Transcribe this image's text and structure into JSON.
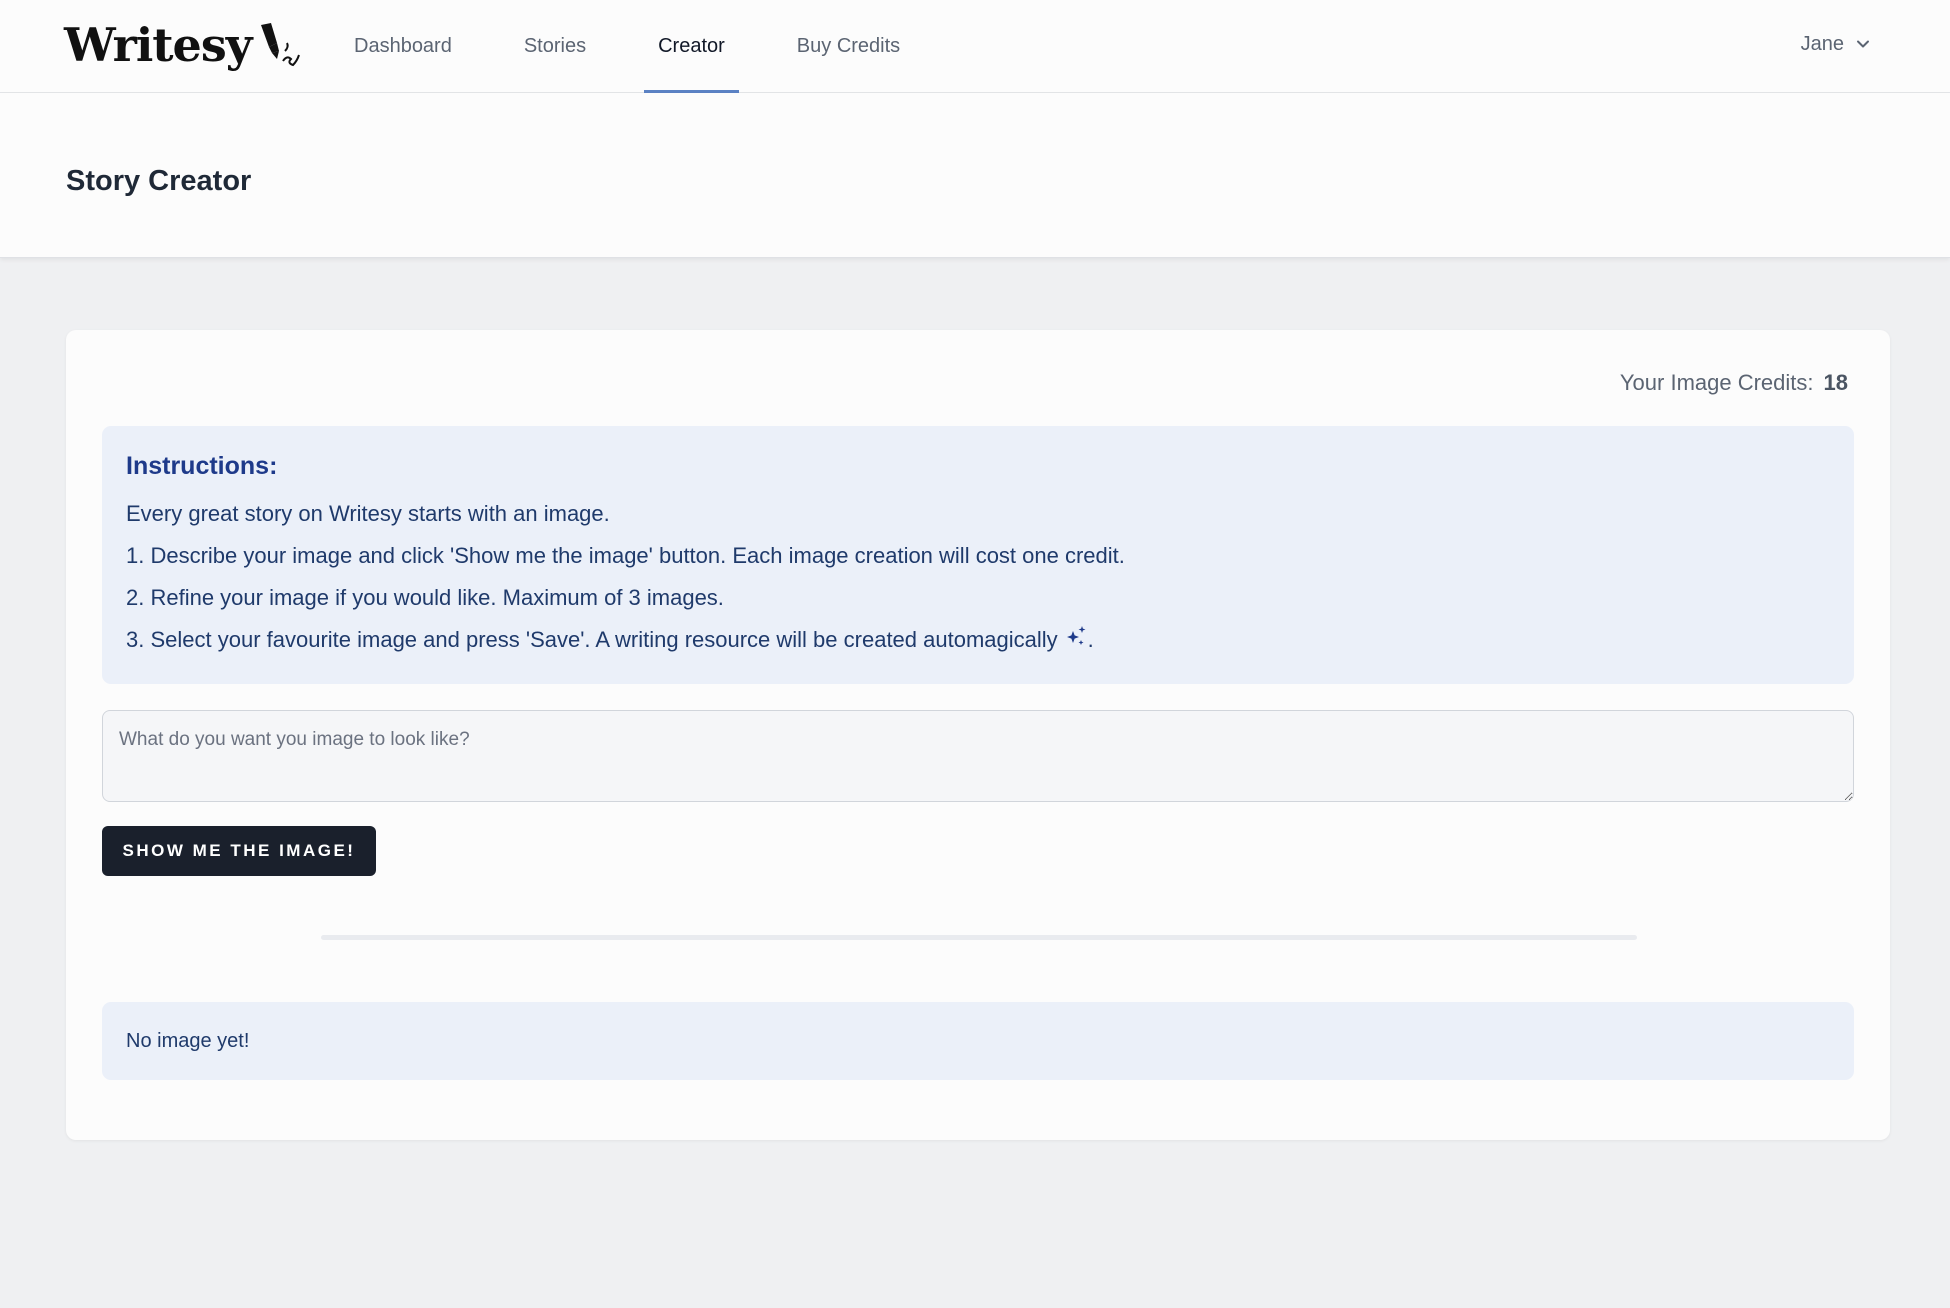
{
  "brand": {
    "name": "Writesy"
  },
  "nav": {
    "links": [
      {
        "label": "Dashboard",
        "active": false
      },
      {
        "label": "Stories",
        "active": false
      },
      {
        "label": "Creator",
        "active": true
      },
      {
        "label": "Buy Credits",
        "active": false
      }
    ],
    "user": "Jane"
  },
  "header": {
    "title": "Story Creator"
  },
  "card": {
    "credits_label": "Your Image Credits:",
    "credits_count": "18",
    "instructions": {
      "title": "Instructions:",
      "intro": "Every great story on Writesy starts with an image.",
      "step1": "1. Describe your image and click 'Show me the image' button. Each image creation will cost one credit.",
      "step2": "2. Refine your image if you would like. Maximum of 3 images.",
      "step3": "3. Select your favourite image and press 'Save'. A writing resource will be created automagically",
      "step3_end": "."
    },
    "prompt": {
      "placeholder": "What do you want you image to look like?",
      "value": ""
    },
    "button_label": "SHOW ME THE IMAGE!",
    "progress": 0,
    "empty_state": "No image yet!"
  },
  "colors": {
    "accent": "#5b82c4",
    "button_bg": "#1a202c",
    "info_bg": "#ebf0f9",
    "info_text": "#1f3a6b"
  },
  "icons": {
    "logo": "pen-nib-icon",
    "user_menu": "chevron-down-icon",
    "magic": "sparkles-icon"
  }
}
